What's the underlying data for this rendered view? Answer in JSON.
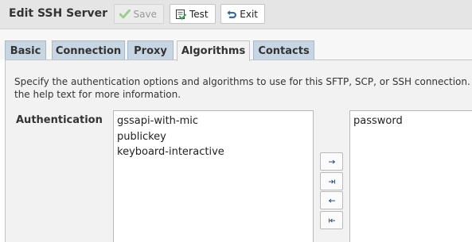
{
  "window": {
    "title": "Edit SSH Server"
  },
  "toolbar": {
    "save_label": "Save",
    "test_label": "Test",
    "exit_label": "Exit"
  },
  "tabs": [
    {
      "label": "Basic"
    },
    {
      "label": "Connection"
    },
    {
      "label": "Proxy"
    },
    {
      "label": "Algorithms",
      "active": true
    },
    {
      "label": "Contacts"
    }
  ],
  "description": {
    "line1": "Specify the authentication options and algorithms to use for this SFTP, SCP, or SSH connection.",
    "line2": "the help text for more information."
  },
  "authentication": {
    "label": "Authentication",
    "available": [
      "gssapi-with-mic",
      "publickey",
      "keyboard-interactive"
    ],
    "selected": [
      "password"
    ]
  },
  "colors": {
    "tab_inactive": "#c8d6e4",
    "tab_active": "#f2f2f2",
    "panel_bg": "#f2f2f2",
    "titlebar_bg": "#e5e5e5",
    "save_check": "#9ccf8a",
    "exit_icon": "#2a5fa8"
  },
  "icons": {
    "save": "check-icon",
    "test": "test-doc-icon",
    "exit": "undo-arrow-icon",
    "add": "arrow-right-icon",
    "add_all": "arrow-right-bar-icon",
    "remove": "arrow-left-icon",
    "remove_all": "arrow-left-bar-icon"
  }
}
